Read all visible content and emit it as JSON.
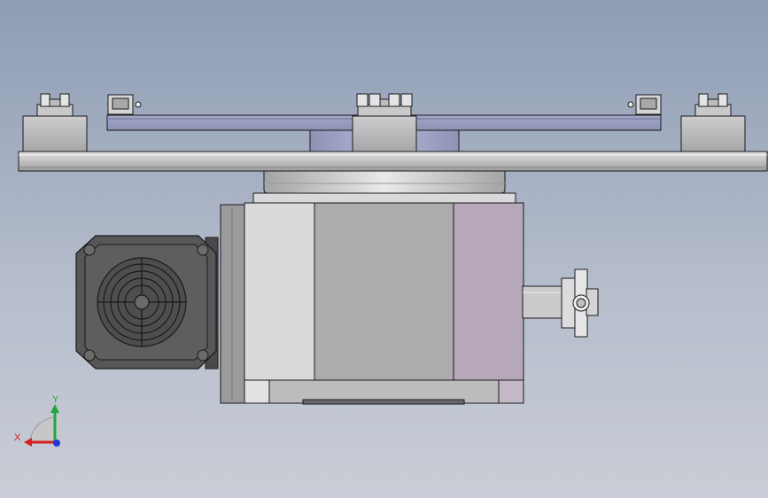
{
  "viewport": {
    "background_top": "#8e9cb4",
    "background_bottom": "#c9cdd6"
  },
  "triad": {
    "x_label": "X",
    "y_label": "Y",
    "x_color": "#d42020",
    "y_color": "#22a83a",
    "z_color": "#2038d8"
  },
  "model": {
    "line_color": "#1a1a1a",
    "plate_color": "#c4c2c4",
    "body_color": "#acacae",
    "panel_color": "#b6a8b8",
    "motor_color": "#575757"
  }
}
